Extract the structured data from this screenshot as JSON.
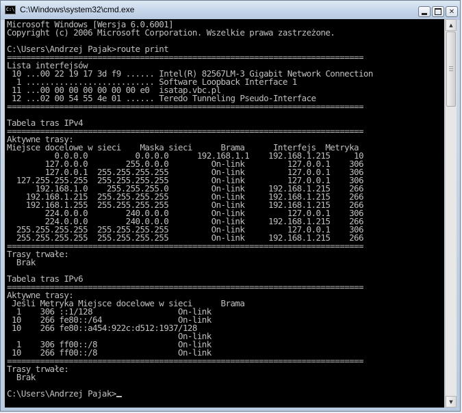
{
  "window": {
    "title": "C:\\Windows\\system32\\cmd.exe",
    "icon": "cmd-icon",
    "icon_text": "C:\\"
  },
  "controls": {
    "minimize": "minimize-icon",
    "maximize": "maximize-icon",
    "close_label": "✕"
  },
  "console": {
    "text": "Microsoft Windows [Wersja 6.0.6001]\nCopyright (c) 2006 Microsoft Corporation. Wszelkie prawa zastrzeżone.\n\nC:\\Users\\Andrzej Pajak>route print\n===========================================================================\nLista interfejsów\n 10 ...00 22 19 17 3d f9 ...... Intel(R) 82567LM-3 Gigabit Network Connection\n  1 ........................... Software Loopback Interface 1\n 11 ...00 00 00 00 00 00 00 e0  isatap.vbc.pl\n 12 ...02 00 54 55 4e 01 ...... Teredo Tunneling Pseudo-Interface\n===========================================================================\n\nTabela tras IPv4\n===========================================================================\nAktywne trasy:\nMiejsce docelowe w sieci    Maska sieci      Brama      Interfejs  Metryka\n          0.0.0.0          0.0.0.0      192.168.1.1    192.168.1.215     10\n        127.0.0.0        255.0.0.0         On-link         127.0.0.1    306\n        127.0.0.1  255.255.255.255         On-link         127.0.0.1    306\n  127.255.255.255  255.255.255.255         On-link         127.0.0.1    306\n      192.168.1.0    255.255.255.0         On-link     192.168.1.215    266\n    192.168.1.215  255.255.255.255         On-link     192.168.1.215    266\n    192.168.1.255  255.255.255.255         On-link     192.168.1.215    266\n        224.0.0.0        240.0.0.0         On-link         127.0.0.1    306\n        224.0.0.0        240.0.0.0         On-link     192.168.1.215    266\n  255.255.255.255  255.255.255.255         On-link         127.0.0.1    306\n  255.255.255.255  255.255.255.255         On-link     192.168.1.215    266\n===========================================================================\nTrasy trwałe:\n  Brak\n\nTabela tras IPv6\n===========================================================================\nAktywne trasy:\n Jeśli Metryka Miejsce docelowe w sieci      Brama\n  1    306 ::1/128                  On-link\n 10    266 fe80::/64                On-link\n 10    266 fe80::a454:922c:d512:1937/128\n                                    On-link\n  1    306 ff00::/8                 On-link\n 10    266 ff00::/8                 On-link\n===========================================================================\nTrasy trwałe:\n  Brak\n\nC:\\Users\\Andrzej Pajak>"
  },
  "scrollbar": {
    "up_icon": "▲",
    "down_icon": "▼"
  }
}
